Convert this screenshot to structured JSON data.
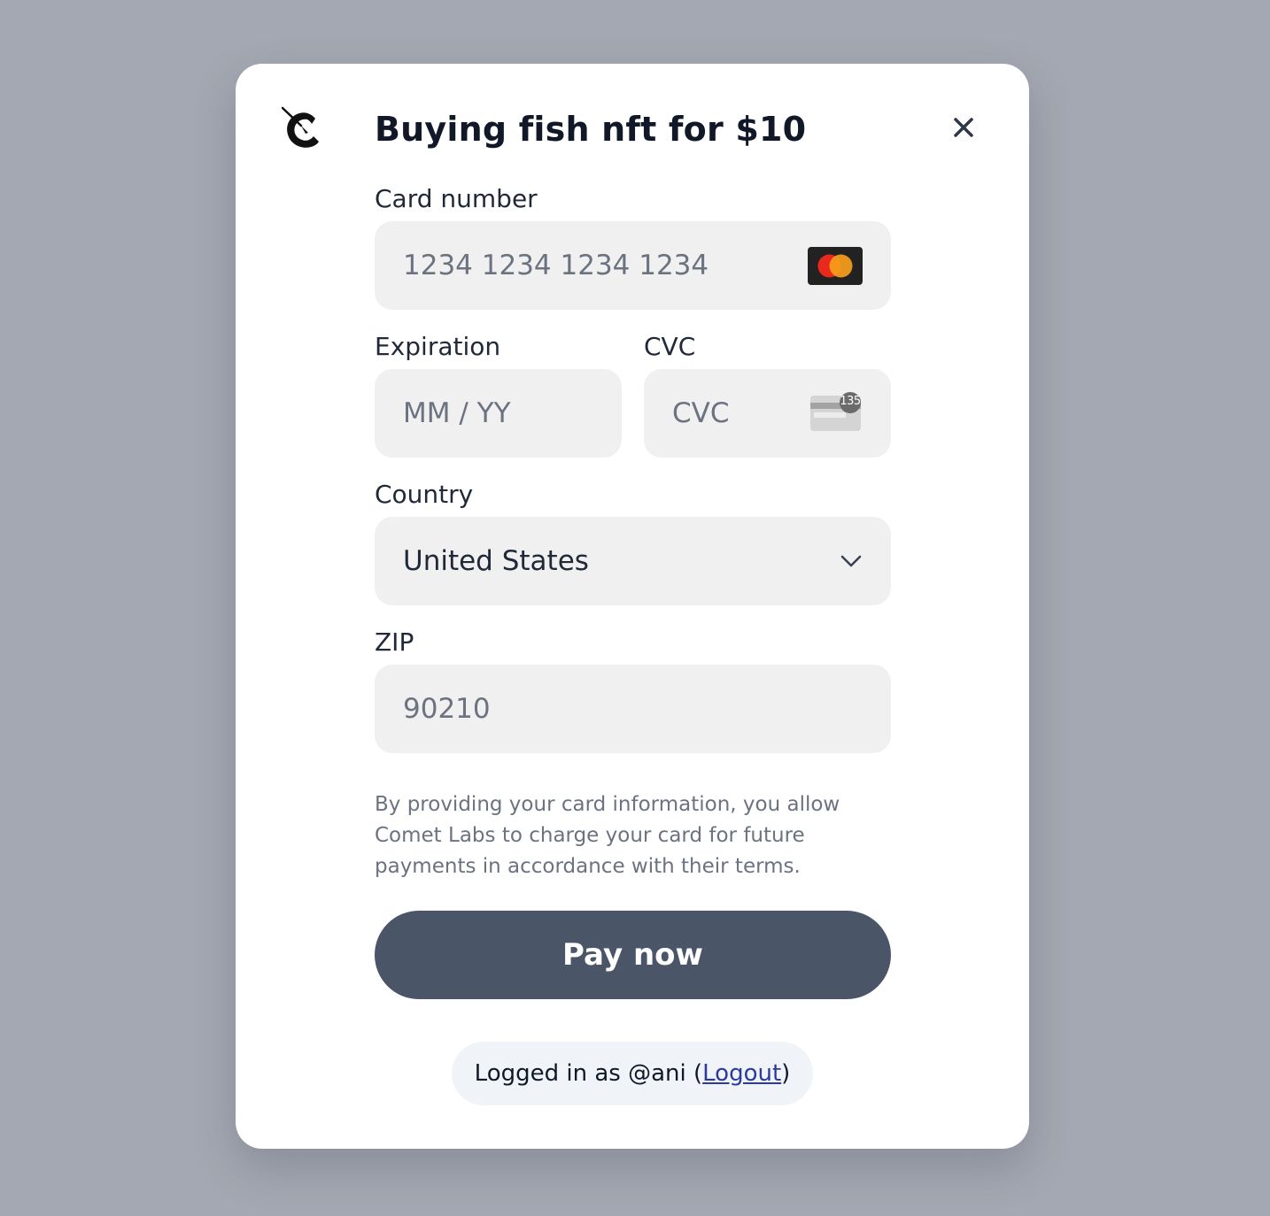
{
  "modal": {
    "title": "Buying fish nft for $10",
    "logo_icon": "comet-logo-icon",
    "close_icon": "close-icon"
  },
  "card_number": {
    "label": "Card number",
    "placeholder": "1234 1234 1234 1234",
    "brand_icon": "mastercard-icon"
  },
  "expiration": {
    "label": "Expiration",
    "placeholder": "MM / YY"
  },
  "cvc": {
    "label": "CVC",
    "placeholder": "CVC",
    "icon": "cvc-card-icon",
    "icon_badge": "135"
  },
  "country": {
    "label": "Country",
    "value": "United States",
    "icon": "chevron-down-icon"
  },
  "zip": {
    "label": "ZIP",
    "placeholder": "90210"
  },
  "disclaimer": "By providing your card information, you allow Comet Labs to charge your card for future payments in accordance with their terms.",
  "pay_button": "Pay now",
  "login": {
    "prefix": "Logged in as @ani (",
    "logout_label": "Logout",
    "suffix": ")"
  },
  "colors": {
    "backdrop": "#a4a8b2",
    "field_bg": "#f0f0f0",
    "button_bg": "#4a5568",
    "link": "#2a3aa0"
  }
}
